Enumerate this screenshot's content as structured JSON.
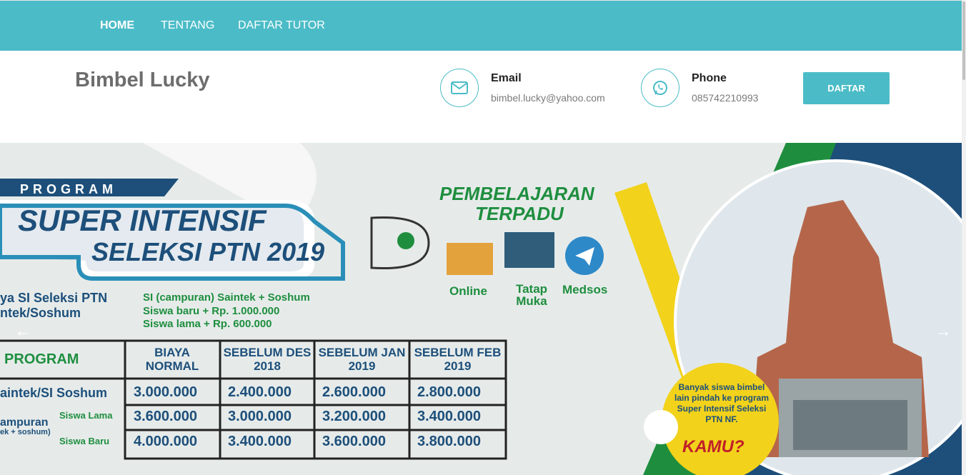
{
  "nav": {
    "items": [
      {
        "label": "HOME",
        "active": true
      },
      {
        "label": "TENTANG",
        "active": false
      },
      {
        "label": "DAFTAR TUTOR",
        "active": false
      }
    ]
  },
  "header": {
    "brand": "Bimbel Lucky",
    "email": {
      "title": "Email",
      "value": "bimbel.lucky@yahoo.com",
      "icon": "envelope-icon"
    },
    "phone": {
      "title": "Phone",
      "value": "085742210993",
      "icon": "whatsapp-icon"
    },
    "cta_label": "DAFTAR"
  },
  "banner": {
    "program_label": "PROGRAM",
    "title_line1": "SUPER INTENSIF",
    "title_line2": "SELEKSI PTN 2019",
    "subtitle_left_1": "ya SI Seleksi PTN",
    "subtitle_left_2": "ntek/Soshum",
    "pricing_head": "SI (campuran) Saintek + Soshum",
    "pricing_new": "Siswa baru  +  Rp.  1.000.000",
    "pricing_old": "Siswa lama  +  Rp.  600.000",
    "learning_title_1": "PEMBELAJARAN",
    "learning_title_2": "TERPADU",
    "modes": [
      "Online",
      "Tatap Muka",
      "Medsos"
    ],
    "table": {
      "headers": [
        "PROGRAM",
        "BIAYA NORMAL",
        "SEBELUM DES 2018",
        "SEBELUM JAN 2019",
        "SEBELUM FEB 2019"
      ],
      "rows": [
        [
          "aintek/SI Soshum",
          "3.000.000",
          "2.400.000",
          "2.600.000",
          "2.800.000"
        ],
        [
          "ampuran",
          "3.600.000",
          "3.000.000",
          "3.200.000",
          "3.400.000"
        ],
        [
          "",
          "4.000.000",
          "3.400.000",
          "3.600.000",
          "3.800.000"
        ]
      ],
      "sub_campuran": "ek + soshum)",
      "siswa_lama": "Siswa Lama",
      "siswa_baru": "Siswa Baru"
    },
    "promo_text": "Banyak siswa bimbel lain pindah ke program Super Intensif Seleksi PTN NF.",
    "promo_kamu": "KAMU?",
    "colors": {
      "teal": "#4bbcc7",
      "navy": "#1d4f7a",
      "green": "#1e8e3e",
      "yellow": "#f2d21b"
    }
  },
  "slider_controls": {
    "prev": "←",
    "next": "→"
  }
}
